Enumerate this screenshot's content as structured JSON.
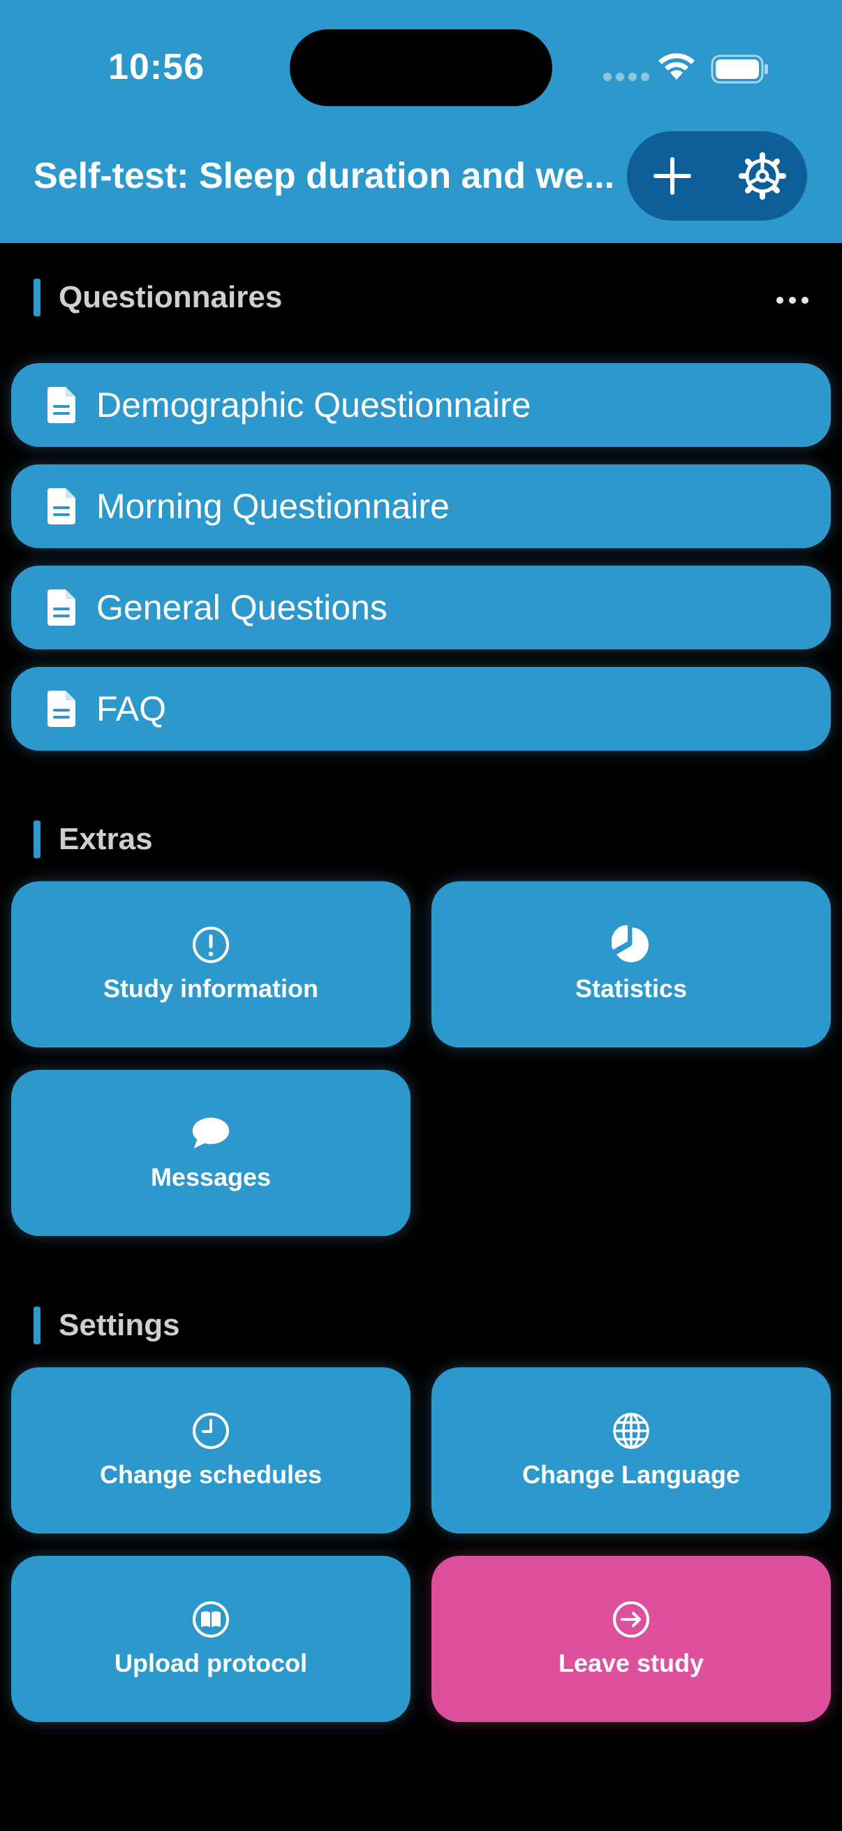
{
  "status_bar": {
    "time": "10:56"
  },
  "header": {
    "title": "Self-test: Sleep duration and we...",
    "add_icon": "plus-icon",
    "settings_icon": "gear-icon"
  },
  "sections": {
    "questionnaires": {
      "title": "Questionnaires",
      "items": [
        {
          "label": "Demographic Questionnaire",
          "icon": "document-icon"
        },
        {
          "label": "Morning Questionnaire",
          "icon": "document-icon"
        },
        {
          "label": "General Questions",
          "icon": "document-icon"
        },
        {
          "label": "FAQ",
          "icon": "document-icon"
        }
      ]
    },
    "extras": {
      "title": "Extras",
      "tiles": [
        {
          "label": "Study information",
          "icon": "info-circle-icon"
        },
        {
          "label": "Statistics",
          "icon": "pie-chart-icon"
        },
        {
          "label": "Messages",
          "icon": "chat-bubble-icon"
        }
      ]
    },
    "settings": {
      "title": "Settings",
      "tiles": [
        {
          "label": "Change schedules",
          "icon": "clock-icon"
        },
        {
          "label": "Change Language",
          "icon": "globe-icon"
        },
        {
          "label": "Upload protocol",
          "icon": "book-icon"
        },
        {
          "label": "Leave study",
          "icon": "exit-arrow-icon"
        }
      ]
    }
  },
  "colors": {
    "primary": "#2d98cb",
    "header_pill": "#0e5f98",
    "danger": "#dc509c",
    "background": "#000000",
    "section_label": "#cfcfcf"
  }
}
